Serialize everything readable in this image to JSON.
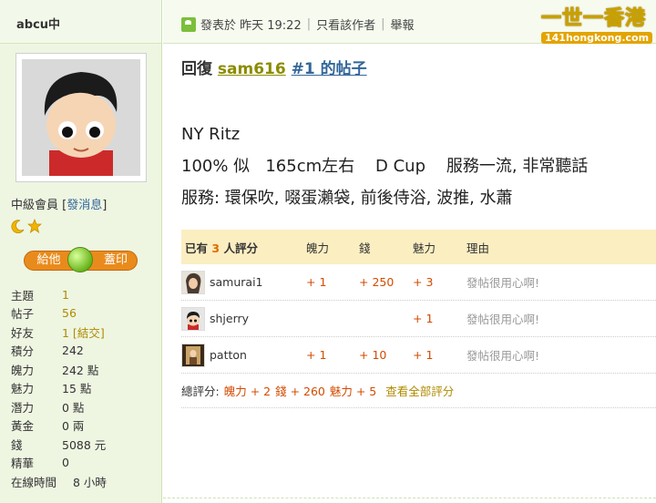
{
  "sidebar": {
    "username": "abcu中",
    "level_text": "中級會員",
    "message_link": "發消息",
    "give_label": "給他",
    "stamp_label": "蓋印",
    "stats": [
      {
        "label": "主題",
        "value": "1"
      },
      {
        "label": "帖子",
        "value": "56"
      },
      {
        "label": "好友",
        "value": "1",
        "extra": "結交"
      },
      {
        "label": "積分",
        "value": "242"
      },
      {
        "label": "魄力",
        "value": "242 點"
      },
      {
        "label": "魅力",
        "value": "15 點"
      },
      {
        "label": "潛力",
        "value": "0 點"
      },
      {
        "label": "黃金",
        "value": "0 兩"
      },
      {
        "label": "錢",
        "value": "5088 元"
      },
      {
        "label": "精華",
        "value": "0"
      },
      {
        "label": "在線時間",
        "value": "8 小時"
      }
    ]
  },
  "post": {
    "posted_at": "發表於 昨天 19:22",
    "only_author": "只看該作者",
    "report": "舉報",
    "logo_main": "一世一香港",
    "logo_url": "141hongkong.com",
    "reply_prefix": "回復",
    "reply_user": "sam616",
    "reply_link": "#1 的帖子",
    "lines": [
      "NY Ritz",
      "100% 似   165cm左右    D Cup    服務一流, 非常聽話",
      "服務: 環保吹, 啜蛋瀨袋, 前後侍浴, 波推, 水蕭"
    ]
  },
  "rating": {
    "header": {
      "prefix": "已有",
      "count": "3",
      "suffix": "人評分",
      "col1": "魄力",
      "col2": "錢",
      "col3": "魅力",
      "col4": "理由"
    },
    "rows": [
      {
        "name": "samurai1",
        "power": "+ 1",
        "money": "+ 250",
        "charm": "+ 3",
        "reason": "發帖很用心啊!"
      },
      {
        "name": "shjerry",
        "power": "",
        "money": "",
        "charm": "+ 1",
        "reason": "發帖很用心啊!"
      },
      {
        "name": "patton",
        "power": "+ 1",
        "money": "+ 10",
        "charm": "+ 1",
        "reason": "發帖很用心啊!"
      }
    ],
    "summary": {
      "label": "總評分:",
      "power": "魄力 + 2",
      "money": "錢 + 260",
      "charm": "魅力 + 5",
      "view_all": "查看全部評分"
    }
  }
}
